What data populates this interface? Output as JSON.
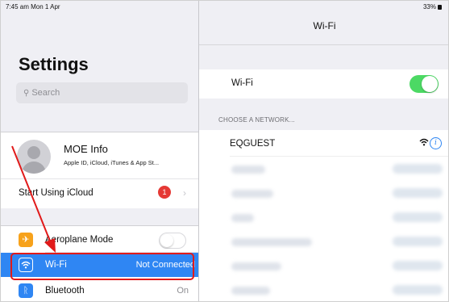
{
  "status_bar": {
    "time": "7:45 am  Mon 1 Apr",
    "battery": "33%"
  },
  "left_pane": {
    "title": "Settings",
    "search": {
      "placeholder": "Search"
    },
    "profile": {
      "name": "MOE Info",
      "subtitle": "Apple ID, iCloud, iTunes & App St..."
    },
    "icloud_prompt": {
      "label": "Start Using iCloud",
      "badge": "1"
    },
    "items": [
      {
        "label": "Aeroplane Mode",
        "icon": "aeroplane-icon",
        "icon_color": "#f7a21b",
        "toggle": false
      },
      {
        "label": "Wi-Fi",
        "value": "Not Connected",
        "icon": "wifi-icon",
        "icon_color": "#2f86f3",
        "selected": true
      },
      {
        "label": "Bluetooth",
        "value": "On",
        "icon": "bluetooth-icon",
        "icon_color": "#2f86f3"
      }
    ]
  },
  "right_pane": {
    "title": "Wi-Fi",
    "wifi_toggle": {
      "label": "Wi-Fi",
      "on": true
    },
    "section_header": "CHOOSE A NETWORK...",
    "networks": [
      {
        "name": "EQGUEST"
      }
    ]
  },
  "colors": {
    "accent": "#2f86f3",
    "toggle_on": "#4cd964",
    "badge": "#e53935",
    "annotation": "#e11a1a"
  }
}
